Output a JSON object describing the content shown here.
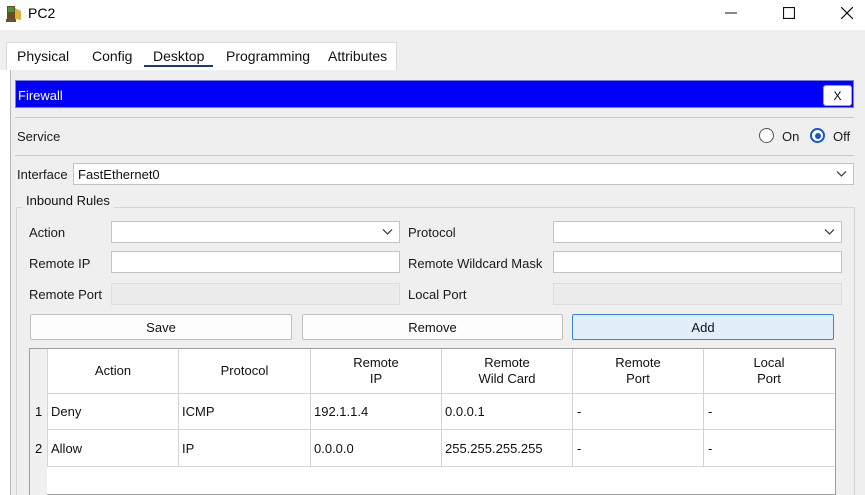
{
  "window": {
    "title": "PC2"
  },
  "tabs": [
    {
      "label": "Physical"
    },
    {
      "label": "Config"
    },
    {
      "label": "Desktop"
    },
    {
      "label": "Programming"
    },
    {
      "label": "Attributes"
    }
  ],
  "active_tab": "Desktop",
  "firewall": {
    "title": "Firewall",
    "close_label": "X"
  },
  "service": {
    "label": "Service",
    "on_label": "On",
    "off_label": "Off",
    "selected": "Off"
  },
  "interface": {
    "label": "Interface",
    "value": "FastEthernet0"
  },
  "inbound": {
    "title": "Inbound Rules",
    "action_label": "Action",
    "action_value": "",
    "protocol_label": "Protocol",
    "protocol_value": "",
    "remote_ip_label": "Remote IP",
    "remote_ip_value": "",
    "remote_wildcard_label": "Remote Wildcard Mask",
    "remote_wildcard_value": "",
    "remote_port_label": "Remote Port",
    "local_port_label": "Local Port"
  },
  "buttons": {
    "save": "Save",
    "remove": "Remove",
    "add": "Add"
  },
  "table": {
    "headers": [
      {
        "line1": "Action",
        "line2": ""
      },
      {
        "line1": "Protocol",
        "line2": ""
      },
      {
        "line1": "Remote",
        "line2": "IP"
      },
      {
        "line1": "Remote",
        "line2": "Wild Card"
      },
      {
        "line1": "Remote",
        "line2": "Port"
      },
      {
        "line1": "Local",
        "line2": "Port"
      }
    ],
    "rows": [
      {
        "index": "1",
        "action": "Deny",
        "protocol": "ICMP",
        "remote_ip": "192.1.1.4",
        "wildcard": "0.0.0.1",
        "remote_port": "-",
        "local_port": "-"
      },
      {
        "index": "2",
        "action": "Allow",
        "protocol": "IP",
        "remote_ip": "0.0.0.0",
        "wildcard": "255.255.255.255",
        "remote_port": "-",
        "local_port": "-"
      }
    ]
  },
  "colors": {
    "firewall_bar": "#0000f8",
    "radio_selected": "#1456c8",
    "add_button_border": "#3b86d6"
  }
}
